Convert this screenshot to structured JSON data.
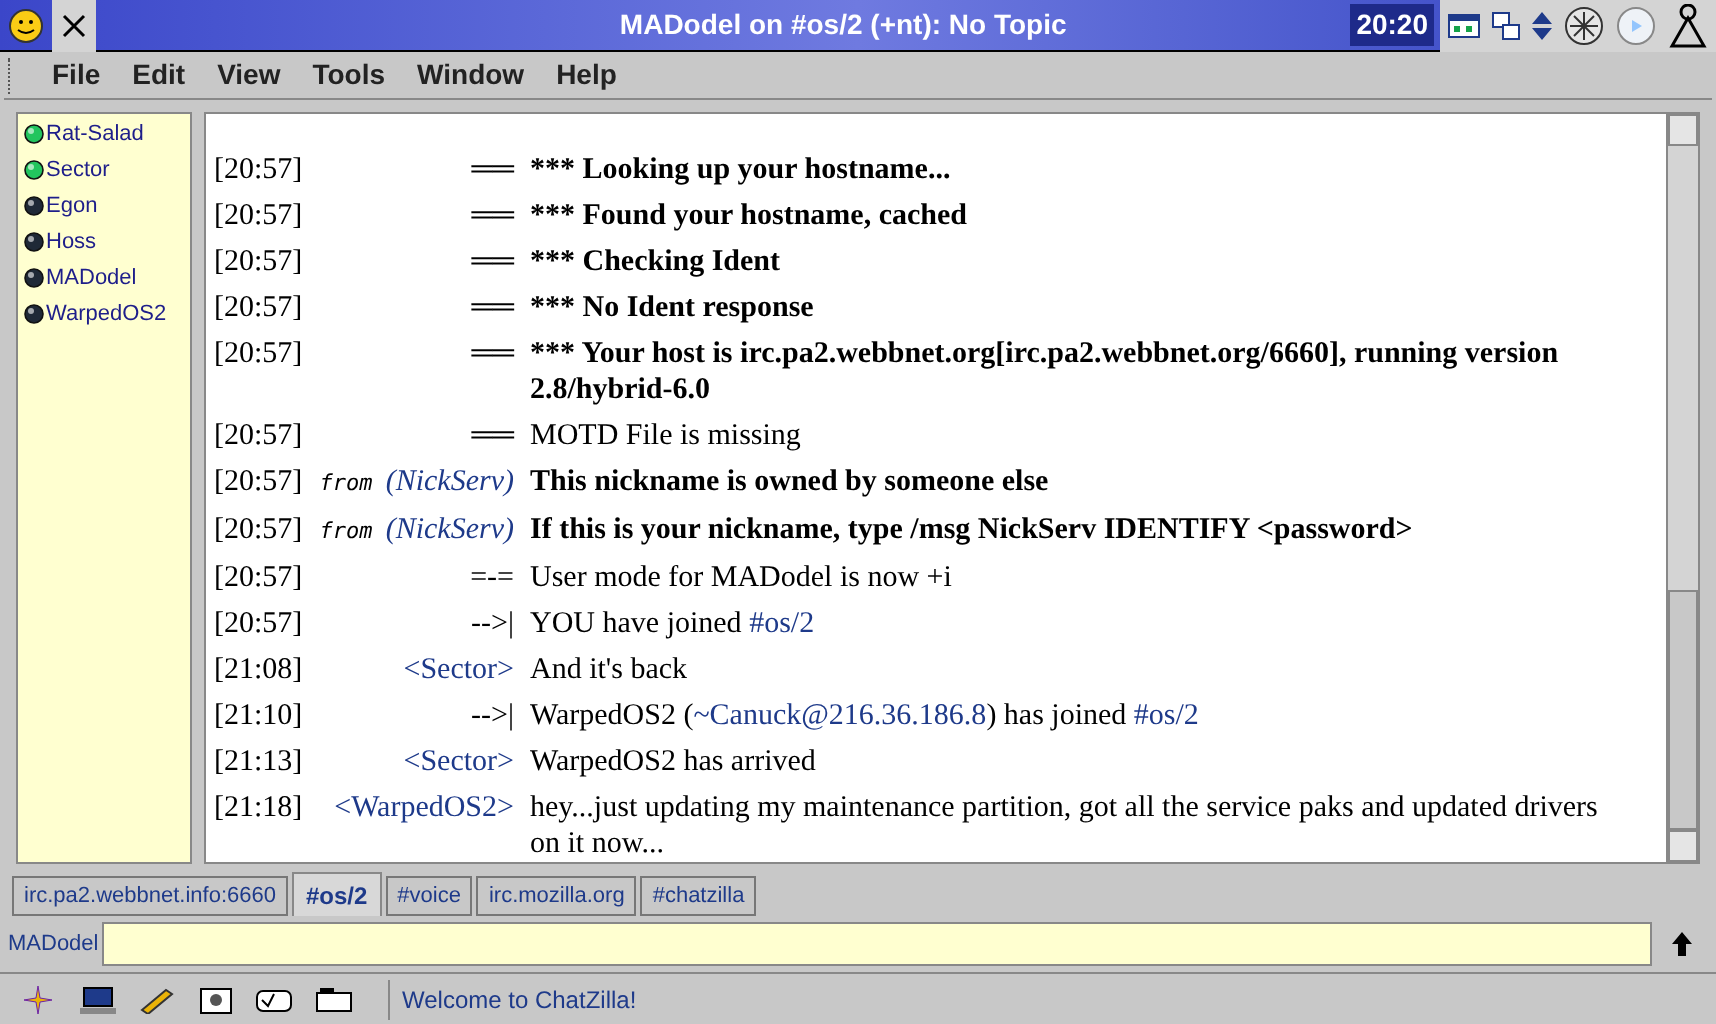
{
  "window": {
    "title": "MADodel on #os/2 (+nt): No Topic",
    "clock": "20:20"
  },
  "menu": [
    "File",
    "Edit",
    "View",
    "Tools",
    "Window",
    "Help"
  ],
  "users": [
    {
      "name": "Rat-Salad",
      "active": true
    },
    {
      "name": "Sector",
      "active": true
    },
    {
      "name": "Egon",
      "active": false
    },
    {
      "name": "Hoss",
      "active": false
    },
    {
      "name": "MADodel",
      "active": false
    },
    {
      "name": "WarpedOS2",
      "active": false
    }
  ],
  "messages": [
    {
      "time": "[20:57]",
      "kind": "system",
      "source": "══",
      "bold": true,
      "parts": [
        {
          "text": "*** Looking up your hostname...",
          "link": false
        }
      ]
    },
    {
      "time": "[20:57]",
      "kind": "system",
      "source": "══",
      "bold": true,
      "parts": [
        {
          "text": "*** Found your hostname, cached",
          "link": false
        }
      ]
    },
    {
      "time": "[20:57]",
      "kind": "system",
      "source": "══",
      "bold": true,
      "parts": [
        {
          "text": "*** Checking Ident",
          "link": false
        }
      ]
    },
    {
      "time": "[20:57]",
      "kind": "system",
      "source": "══",
      "bold": true,
      "parts": [
        {
          "text": "*** No Ident response",
          "link": false
        }
      ]
    },
    {
      "time": "[20:57]",
      "kind": "system",
      "source": "══",
      "bold": true,
      "parts": [
        {
          "text": "*** Your host is irc.pa2.webbnet.org[irc.pa2.webbnet.org/6660], running version 2.8/hybrid-6.0",
          "link": false
        }
      ]
    },
    {
      "time": "[20:57]",
      "kind": "system",
      "source": "══",
      "bold": false,
      "parts": [
        {
          "text": "MOTD File is missing",
          "link": false
        }
      ]
    },
    {
      "time": "[20:57]",
      "kind": "notice",
      "source": "from",
      "nick": "(NickServ)",
      "bold": true,
      "parts": [
        {
          "text": "This nickname is owned by someone else",
          "link": false
        }
      ]
    },
    {
      "time": "[20:57]",
      "kind": "notice",
      "source": "from",
      "nick": "(NickServ)",
      "bold": true,
      "parts": [
        {
          "text": "If this is your nickname, type /msg NickServ IDENTIFY <password>",
          "link": false
        }
      ]
    },
    {
      "time": "[20:57]",
      "kind": "system",
      "source": "=-=",
      "bold": false,
      "parts": [
        {
          "text": "User mode for MADodel is now +i",
          "link": false
        }
      ]
    },
    {
      "time": "[20:57]",
      "kind": "system",
      "source": "-->|",
      "bold": false,
      "parts": [
        {
          "text": "YOU have joined ",
          "link": false
        },
        {
          "text": "#os/2",
          "link": true
        }
      ]
    },
    {
      "time": "[21:08]",
      "kind": "nick",
      "source": "<Sector>",
      "bold": false,
      "parts": [
        {
          "text": "And it's back",
          "link": false
        }
      ]
    },
    {
      "time": "[21:10]",
      "kind": "system",
      "source": "-->|",
      "bold": false,
      "parts": [
        {
          "text": "WarpedOS2 (",
          "link": false
        },
        {
          "text": "~Canuck@216.36.186.8",
          "link": true
        },
        {
          "text": ") has joined ",
          "link": false
        },
        {
          "text": "#os/2",
          "link": true
        }
      ]
    },
    {
      "time": "[21:13]",
      "kind": "nick",
      "source": "<Sector>",
      "bold": false,
      "parts": [
        {
          "text": "WarpedOS2 has arrived",
          "link": false
        }
      ]
    },
    {
      "time": "[21:18]",
      "kind": "nick",
      "source": "<WarpedOS2>",
      "bold": false,
      "parts": [
        {
          "text": "hey...just updating my maintenance partition, got all the service paks and updated drivers on it now...",
          "link": false
        }
      ]
    }
  ],
  "tabs": [
    {
      "label": "irc.pa2.webbnet.info:6660",
      "selected": false
    },
    {
      "label": "#os/2",
      "selected": true
    },
    {
      "label": "#voice",
      "selected": false
    },
    {
      "label": "irc.mozilla.org",
      "selected": false
    },
    {
      "label": "#chatzilla",
      "selected": false
    }
  ],
  "input": {
    "nick": "MADodel"
  },
  "status": "Welcome to ChatZilla!"
}
